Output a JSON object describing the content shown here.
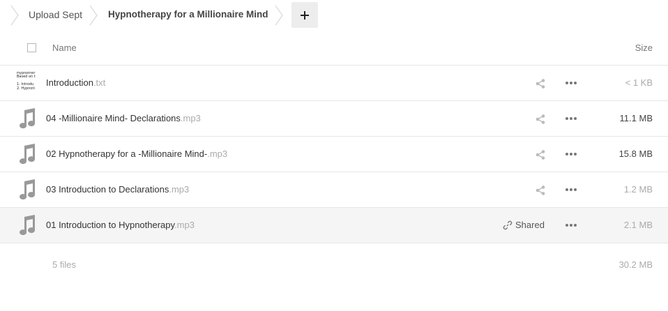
{
  "breadcrumb": {
    "root": "Upload Sept",
    "current": "Hypnotherapy for a Millionaire Mind",
    "add_label": "+"
  },
  "header": {
    "name_col": "Name",
    "size_col": "Size"
  },
  "files": [
    {
      "base": "Introduction",
      "ext": ".txt",
      "size": "< 1 KB",
      "type": "text",
      "shared": false,
      "preview_lines": [
        "Hypnother",
        "Based on t",
        "",
        "1. Introdu",
        "2. Hypnoti"
      ]
    },
    {
      "base": "04 -Millionaire Mind- Declarations",
      "ext": ".mp3",
      "size": "11.1 MB",
      "type": "audio",
      "shared": false
    },
    {
      "base": "02 Hypnotherapy for a -Millionaire Mind-",
      "ext": ".mp3",
      "size": "15.8 MB",
      "type": "audio",
      "shared": false
    },
    {
      "base": "03 Introduction to Declarations",
      "ext": ".mp3",
      "size": "1.2 MB",
      "type": "audio",
      "shared": false
    },
    {
      "base": "01 Introduction to Hypnotherapy",
      "ext": ".mp3",
      "size": "2.1 MB",
      "type": "audio",
      "shared": true,
      "shared_label": "Shared"
    }
  ],
  "footer": {
    "count": "5 files",
    "total": "30.2 MB"
  },
  "icons": {
    "file": "music-note-icon",
    "share": "share-icon",
    "more": "more-icon",
    "link": "link-icon"
  }
}
